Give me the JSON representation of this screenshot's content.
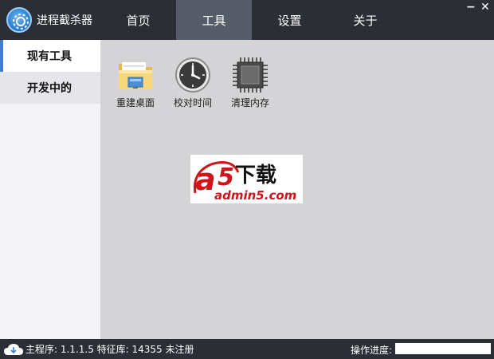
{
  "app": {
    "title": "进程截杀器"
  },
  "nav": {
    "tabs": [
      {
        "label": "首页",
        "active": false
      },
      {
        "label": "工具",
        "active": true
      },
      {
        "label": "设置",
        "active": false
      },
      {
        "label": "关于",
        "active": false
      }
    ]
  },
  "window_controls": {
    "minimize": "−",
    "close": "✕"
  },
  "sidebar": {
    "items": [
      {
        "label": "现有工具",
        "active": true
      },
      {
        "label": "开发中的",
        "active": false
      }
    ]
  },
  "tools": [
    {
      "label": "重建桌面",
      "icon": "folder-icon"
    },
    {
      "label": "校对时间",
      "icon": "clock-icon"
    },
    {
      "label": "清理内存",
      "icon": "chip-icon"
    }
  ],
  "ad_banner": {
    "brand_letter": "a",
    "digit": "5",
    "text": "下载",
    "url": "admin5.com"
  },
  "status": {
    "text": "主程序: 1.1.1.5 特征库: 14355 未注册",
    "progress_label": "操作进度:",
    "progress": 0
  },
  "colors": {
    "topbar": "#2b2e34",
    "active_tab": "#565c68",
    "accent": "#3e7fcf",
    "sidebar": "#f3f2f6",
    "main": "#d4d3d6"
  }
}
